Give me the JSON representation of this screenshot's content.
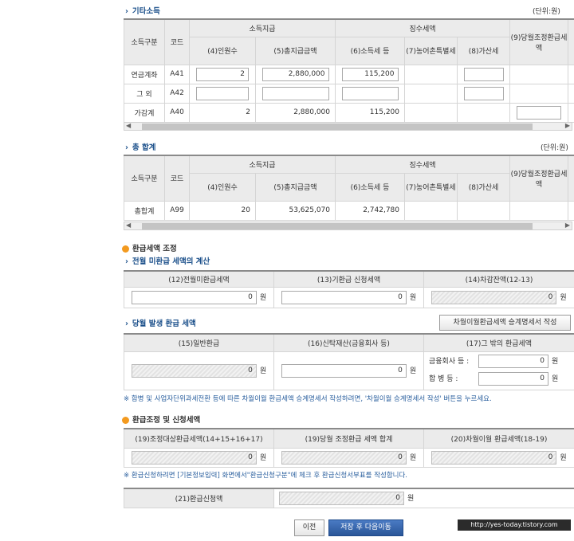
{
  "sec1": {
    "title": "기타소득",
    "unit": "(단위:원)"
  },
  "sec2": {
    "title": "총 합계",
    "unit": "(단위:원)"
  },
  "hdr": {
    "c1": "소득구분",
    "c2": "코드",
    "g1": "소득지급",
    "g2": "징수세액",
    "c4": "(4)인원수",
    "c5": "(5)총지급금액",
    "c6": "(6)소득세 등",
    "c7": "(7)농어촌특별세",
    "c8": "(8)가산세",
    "c9": "(9)당월조정환급세액"
  },
  "t1": [
    {
      "k": "연금계좌",
      "code": "A41",
      "n": "2",
      "amt": "2,880,000",
      "tax": "115,200"
    },
    {
      "k": "그 외",
      "code": "A42",
      "n": "",
      "amt": "",
      "tax": ""
    },
    {
      "k": "가감계",
      "code": "A40",
      "n": "2",
      "amt": "2,880,000",
      "tax": "115,200"
    }
  ],
  "t2": {
    "k": "총합계",
    "code": "A99",
    "n": "20",
    "amt": "53,625,070",
    "tax": "2,742,780"
  },
  "adj": {
    "title": "환급세액 조정",
    "sub1": "전월 미환급 세액의 계산",
    "c12": "(12)전월미환급세액",
    "c13": "(13)기환급 신청세액",
    "c14": "(14)차감잔액(12-13)",
    "v": "0",
    "won": "원",
    "sub2": "당월 발생 환급 세액",
    "btn": "차월이월환급세액 승계명세서 작성",
    "c15": "(15)일반환급",
    "c16": "(16)신탁재산(금융회사 등)",
    "c17": "(17)그 밖의 환급세액",
    "fin": "금융회사 등 :",
    "merge": "합 병 등 :",
    "note": "※ 합병 및 사업자단위과세전환 등에 따른 차월이월 환급세액 승계명세서 작성하려면, '차월이월 승계명세서 작성' 버튼을 누르세요."
  },
  "req": {
    "title": "환급조정 및 신청세액",
    "c19": "(19)조정대상환급세액(14+15+16+17)",
    "c19b": "(19)당월 조정환급 세액 합계",
    "c20": "(20)차월이월 환급세액(18-19)",
    "note": "※ 환급신청하려면 [기본정보입력] 화면에서\"환급신청구분\"에 체크 후 환급신청서부표를 작성합니다.",
    "c21": "(21)환급신청액"
  },
  "btns": {
    "prev": "이전",
    "next": "저장 후 다음이동"
  },
  "wm": "http://yes-today.tistory.com"
}
